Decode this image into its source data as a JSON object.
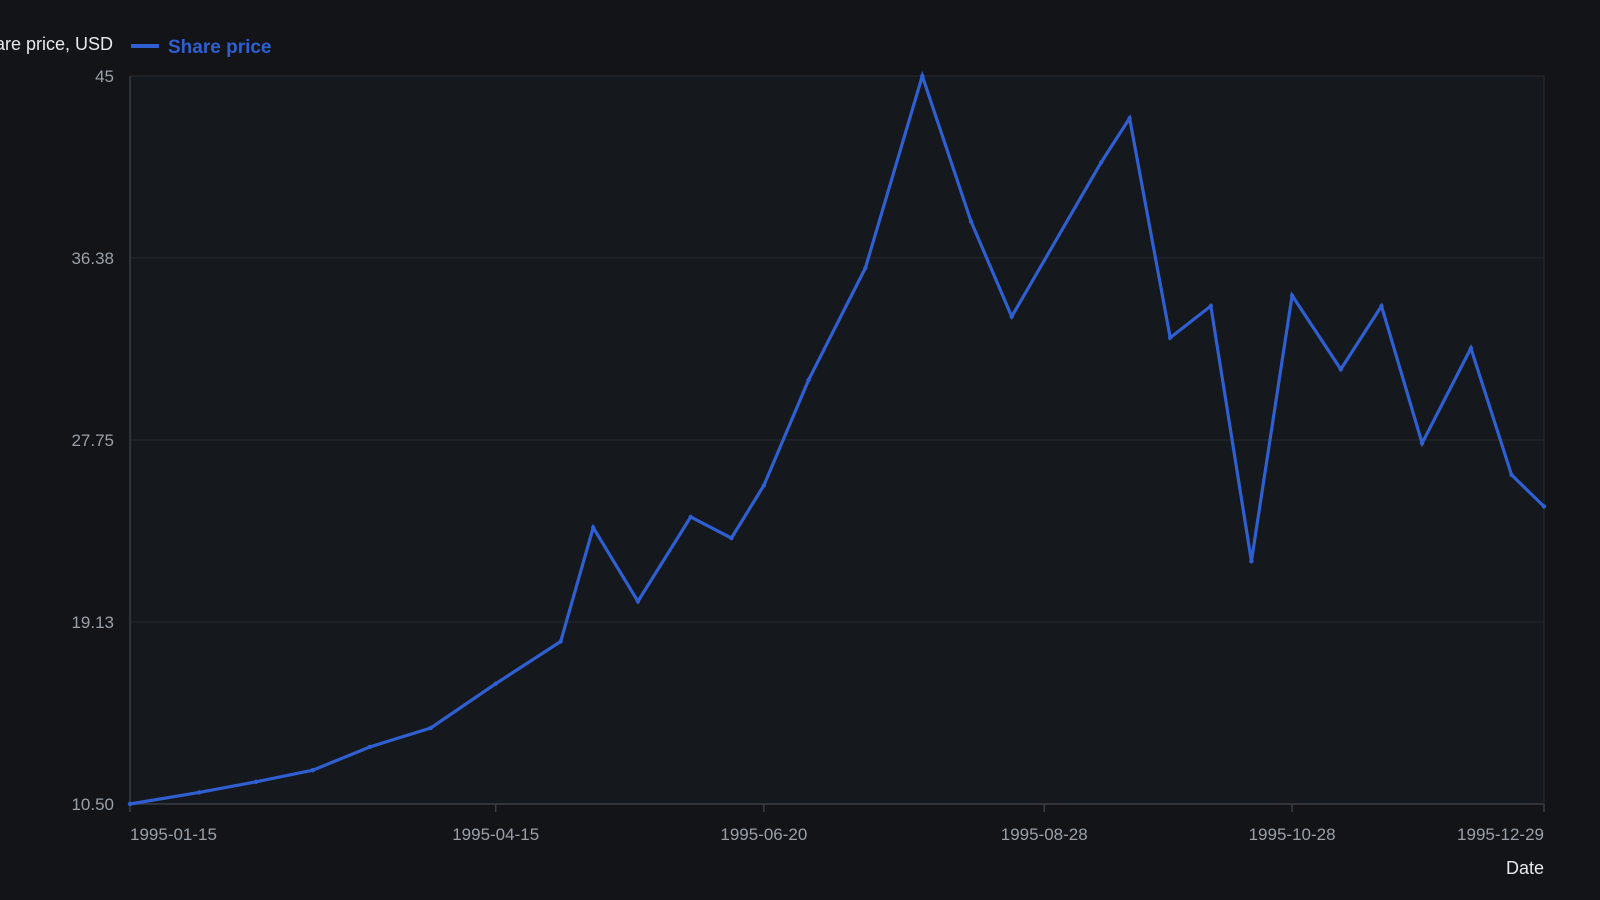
{
  "colors": {
    "background": "#121418",
    "plot_background": "#15181d",
    "grid": "#262a30",
    "axis": "#3a3f46",
    "series": "#2f5fd0"
  },
  "chart_data": {
    "type": "line",
    "title": "",
    "xlabel": "Date",
    "ylabel": "Share price, USD",
    "ylim": [
      10.5,
      45
    ],
    "yticks": [
      "10.50",
      "19.13",
      "27.75",
      "36.38",
      "45"
    ],
    "xlim": [
      "1995-01-15",
      "1995-12-29"
    ],
    "xticks": [
      "1995-01-15",
      "1995-04-15",
      "1995-06-20",
      "1995-08-28",
      "1995-10-28",
      "1995-12-29"
    ],
    "grid": true,
    "legend": "top-left",
    "series": [
      {
        "name": "Share price",
        "x": [
          "1995-01-15",
          "1995-02-01",
          "1995-02-15",
          "1995-03-01",
          "1995-03-15",
          "1995-03-30",
          "1995-04-15",
          "1995-05-01",
          "1995-05-09",
          "1995-05-20",
          "1995-06-02",
          "1995-06-12",
          "1995-06-20",
          "1995-07-01",
          "1995-07-15",
          "1995-07-29",
          "1995-08-10",
          "1995-08-20",
          "1995-09-11",
          "1995-09-18",
          "1995-09-28",
          "1995-10-08",
          "1995-10-18",
          "1995-10-28",
          "1995-11-09",
          "1995-11-19",
          "1995-11-29",
          "1995-12-11",
          "1995-12-21",
          "1995-12-29"
        ],
        "values": [
          10.5,
          11.05,
          11.55,
          12.1,
          13.2,
          14.1,
          16.2,
          18.2,
          23.6,
          20.1,
          24.1,
          23.1,
          25.6,
          30.6,
          35.9,
          45.0,
          38.1,
          33.6,
          40.9,
          43.0,
          32.6,
          34.1,
          22.0,
          34.6,
          31.1,
          34.1,
          27.6,
          32.1,
          26.1,
          24.6
        ]
      }
    ]
  }
}
